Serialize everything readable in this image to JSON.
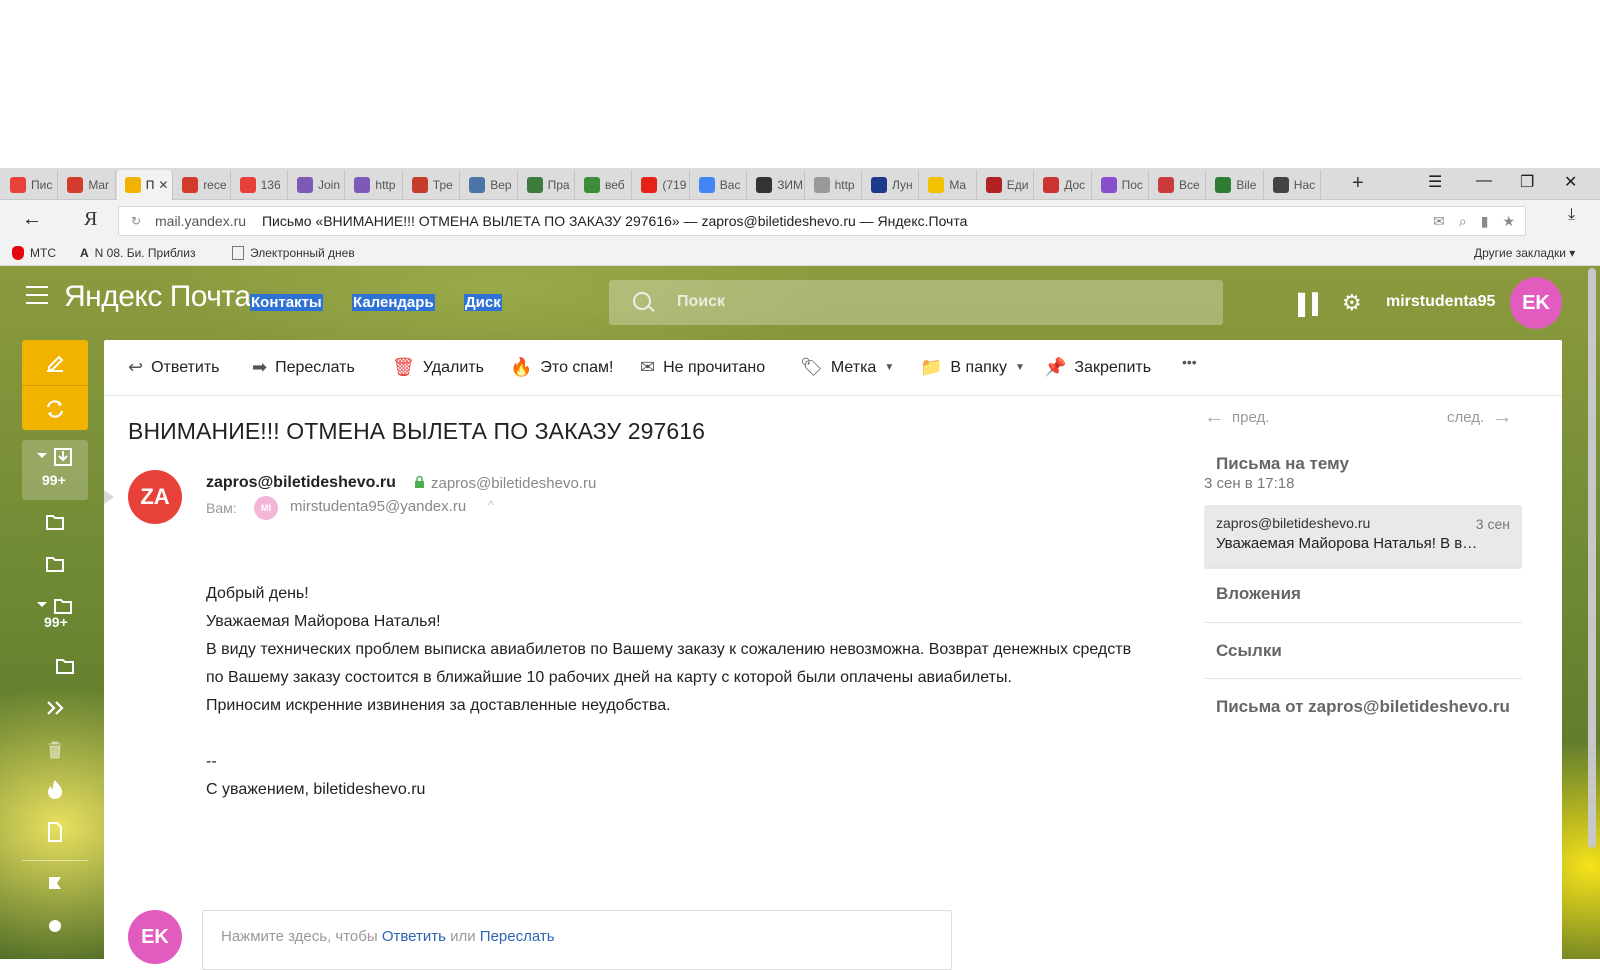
{
  "browser": {
    "tabs": [
      {
        "label": "Пис",
        "color": "#e8413a"
      },
      {
        "label": "Mar",
        "color": "#d33b2c"
      },
      {
        "label": "П",
        "color": "#f2b300",
        "active": true
      },
      {
        "label": "rece",
        "color": "#d33b2c"
      },
      {
        "label": "136",
        "color": "#e8413a"
      },
      {
        "label": "Join",
        "color": "#7d5ab8"
      },
      {
        "label": "http",
        "color": "#7d5ab8"
      },
      {
        "label": "Тре",
        "color": "#c63b2a"
      },
      {
        "label": "Вер",
        "color": "#4a76a8"
      },
      {
        "label": "Пра",
        "color": "#3c7b3c"
      },
      {
        "label": "веб",
        "color": "#3c8c3c"
      },
      {
        "label": "(719",
        "color": "#e62117"
      },
      {
        "label": "Вас",
        "color": "#4285f4"
      },
      {
        "label": "ЗИМ",
        "color": "#333333"
      },
      {
        "label": "http",
        "color": "#999999"
      },
      {
        "label": "Лун",
        "color": "#1f3a8a"
      },
      {
        "label": "Ma",
        "color": "#f2c200"
      },
      {
        "label": "Еди",
        "color": "#b22222"
      },
      {
        "label": "Дос",
        "color": "#cc3333"
      },
      {
        "label": "Пос",
        "color": "#8a4fcc"
      },
      {
        "label": "Все",
        "color": "#cc3b3b"
      },
      {
        "label": "Bile",
        "color": "#2e7d32"
      },
      {
        "label": "Нас",
        "color": "#444444"
      }
    ],
    "tab_close": "✕",
    "new_tab": "+",
    "address": {
      "domain": "mail.yandex.ru",
      "title": "Письмо «ВНИМАНИЕ!!! ОТМЕНА ВЫЛЕТА ПО ЗАКАЗУ 297616» — zapros@biletideshevo.ru — Яндекс.Почта"
    },
    "ya_button": "Я",
    "bookmarks": [
      {
        "label": "МТС"
      },
      {
        "label": "N 08. Би. Приблиз"
      },
      {
        "label": "Электронный днев"
      }
    ],
    "other_bookmarks": "Другие закладки ▾"
  },
  "mail": {
    "logo": "Яндекс Почта",
    "nav_links": [
      "Контакты",
      "Календарь",
      "Диск"
    ],
    "search_placeholder": "Поиск",
    "username": "mirstudenta95",
    "user_initials": "EK",
    "inbox_count": "99+",
    "folder_count": "99+",
    "toolbar": {
      "reply": "Ответить",
      "forward": "Переслать",
      "delete": "Удалить",
      "spam": "Это спам!",
      "unread": "Не прочитано",
      "label": "Метка",
      "move": "В папку",
      "pin": "Закрепить",
      "more": "•••"
    },
    "message": {
      "subject": "ВНИМАНИЕ!!! ОТМЕНА ВЫЛЕТА ПО ЗАКАЗУ 297616",
      "sender_initials": "ZA",
      "from_name": "zapros@biletideshevo.ru",
      "from_address": "zapros@biletideshevo.ru",
      "date": "3 сен в 17:18",
      "to_label": "Вам:",
      "to_initials": "MI",
      "to_address": "mirstudenta95@yandex.ru",
      "body": [
        "Добрый день!",
        "Уважаемая Майорова Наталья!",
        "В виду технических проблем выписка авиабилетов по Вашему заказу к сожалению невозможна. Возврат денежных средств по Вашему заказу состоится в ближайшие 10 рабочих дней на карту с которой были оплачены авиабилеты.",
        "Приносим искренние извинения за доставленные неудобства.",
        "--",
        "С уважением, biletideshevo.ru"
      ]
    },
    "reply_box": {
      "prefix": "Нажмите здесь, чтобы ",
      "reply_link": "Ответить",
      "middle": " или ",
      "forward_link": "Переслать"
    },
    "sidebar": {
      "prev": "пред.",
      "next": "след.",
      "thread_heading": "Письма на тему",
      "thread_item": {
        "from": "zapros@biletideshevo.ru",
        "date": "3 сен",
        "snippet": "Уважаемая Майорова Наталья! В в…"
      },
      "attachments": "Вложения",
      "links": "Ссылки",
      "from_sender": "Письма от zapros@biletideshevo.ru"
    }
  }
}
